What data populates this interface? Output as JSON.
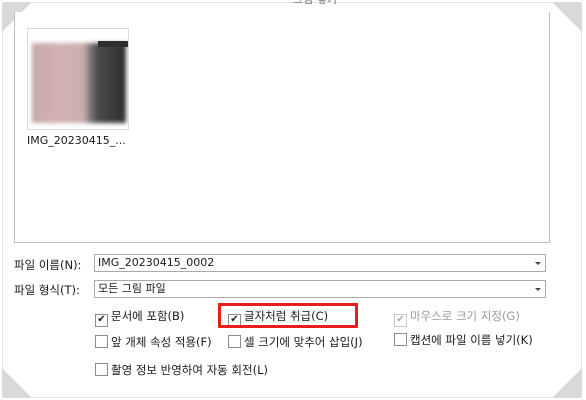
{
  "dialog": {
    "title": "그림 넣기"
  },
  "file_list": {
    "items": [
      {
        "name": "IMG_20230415_..."
      }
    ]
  },
  "filename_row": {
    "label": "파일 이름(N):",
    "value": "IMG_20230415_0002"
  },
  "filetype_row": {
    "label": "파일 형식(T):",
    "value": "모든 그림 파일"
  },
  "options": {
    "include_in_doc": {
      "label": "문서에 포함(B)",
      "checked": true,
      "checkmark": "✔"
    },
    "treat_as_char": {
      "label": "글자처럼 취급(C)",
      "checked": true,
      "checkmark": "✔"
    },
    "mouse_size": {
      "label": "마우스로 크기 지정(G)",
      "checked": true,
      "checkmark": "✔"
    },
    "apply_prev_props": {
      "label": "앞 개체 속성 적용(F)",
      "checked": false
    },
    "fit_cell": {
      "label": "셀 크기에 맞추어 삽입(J)",
      "checked": false
    },
    "caption_filename": {
      "label": "캡션에 파일 이름 넣기(K)",
      "checked": false
    },
    "auto_rotate": {
      "label": "촬영 정보 반영하여 자동 회전(L)",
      "checked": false
    }
  },
  "colors": {
    "highlight": "#e61e1e",
    "corner": "#d9d9d9"
  }
}
